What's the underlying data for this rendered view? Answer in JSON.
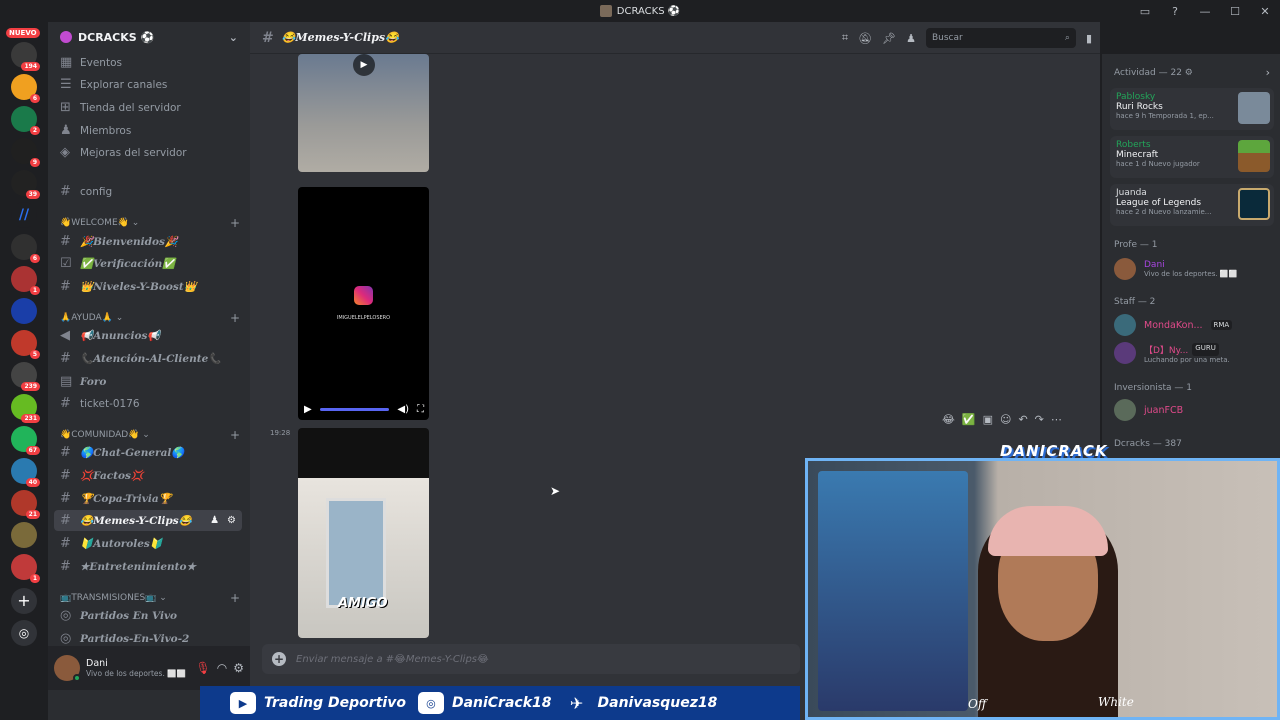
{
  "window": {
    "title": "DCRACKS ⚽"
  },
  "servers": {
    "nuevo_label": "NUEVO",
    "badges": [
      "194",
      "6",
      "2",
      "9",
      "39",
      "",
      "6",
      "1",
      "5",
      "239",
      "231",
      "67",
      "40",
      "21",
      "1",
      "1"
    ]
  },
  "sidebar": {
    "server_name": "DCRACKS ⚽",
    "top_items": [
      "Eventos",
      "Explorar canales",
      "Tienda del servidor",
      "Miembros",
      "Mejoras del servidor"
    ],
    "config": "config",
    "cat_welcome": "👋WELCOME👋",
    "ch_bienvenidos": "🎉Bienvenidos🎉",
    "ch_verificacion": "✅Verificación✅",
    "ch_niveles": "👑Niveles-Y-Boost👑",
    "cat_ayuda": "🙏AYUDA🙏",
    "ch_anuncios": "📢Anuncios📢",
    "ch_atencion": "📞Atención-Al-Cliente📞",
    "ch_foro": "Foro",
    "ch_ticket": "ticket-0176",
    "cat_comunidad": "👋COMUNIDAD👋",
    "ch_chat": "🌎Chat-General🌎",
    "ch_factos": "💢Factos💢",
    "ch_copa": "🏆Copa-Trivia🏆",
    "ch_memes": "😂Memes-Y-Clips😂",
    "ch_autoroles": "🔰Autoroles🔰",
    "ch_entretenimiento": "★Entretenimiento★",
    "cat_transmisiones": "📺TRANSMISIONES📺",
    "ch_partidos": "Partidos En Vivo",
    "ch_partidos2": "Partidos-En-Vivo-2"
  },
  "user": {
    "name": "Dani",
    "status": "Vivo de los deportes. ⬜⬜"
  },
  "chat": {
    "channel_name": "😂Memes-Y-Clips😂",
    "search_placeholder": "Buscar",
    "timestamp": "19:28",
    "instagram_caption": "IMIGUELELPELOSERO",
    "amigo_overlay": "AMIGO",
    "composer_placeholder": "Enviar mensaje a #😂Memes-Y-Clips😂"
  },
  "members": {
    "activity_header": "Actividad — 22 ⚙",
    "activities": [
      {
        "name": "Pablosky",
        "game": "Ruri Rocks",
        "sub": "hace 9 h  Temporada 1, ep..."
      },
      {
        "name": "Roberts",
        "game": "Minecraft",
        "sub": "hace 1 d  Nuevo jugador"
      },
      {
        "name": "Juanda",
        "game": "League of Legends",
        "sub": "hace 2 d  Nuevo lanzamie..."
      }
    ],
    "cat_profe": "Profe — 1",
    "profe": {
      "name": "Dani",
      "status": "Vivo de los deportes. ⬜⬜"
    },
    "cat_staff": "Staff — 2",
    "staff1": {
      "name": "MondaKon...",
      "tag": "RMA"
    },
    "staff2": {
      "name": "【D】Ny...",
      "tag": "GURU",
      "status": "Luchando por una meta."
    },
    "cat_inversionista": "Inversionista — 1",
    "inversionista": {
      "name": "juanFCB"
    },
    "cat_dcracks": "Dcracks — 387"
  },
  "overlay": {
    "webcam_logo": "DANICRACK",
    "social": [
      {
        "icon": "youtube-icon",
        "label": "Trading Deportivo"
      },
      {
        "icon": "instagram-icon",
        "label": "DaniCrack18"
      },
      {
        "icon": "twitter-icon",
        "label": "Danivasquez18"
      }
    ],
    "shirt_left": "Off",
    "shirt_right": "White"
  },
  "colors": {
    "bg": "#313338",
    "sidebar": "#2b2d31",
    "servers": "#1e1f22",
    "accent": "#5865f2",
    "online": "#23a55a",
    "social_bar": "#0d3a8c",
    "webcam_border": "#6fb4f5"
  }
}
